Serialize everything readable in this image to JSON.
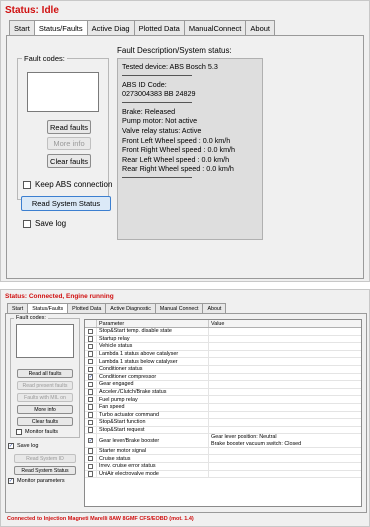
{
  "top": {
    "status": "Status: Idle",
    "tabs": [
      "Start",
      "Status/Faults",
      "Active Diag",
      "Plotted Data",
      "ManualConnect",
      "About"
    ],
    "active_tab": "Status/Faults",
    "fault_codes_label": "Fault codes:",
    "read_faults": "Read faults",
    "more_info": "More info",
    "clear_faults": "Clear faults",
    "keep_abs_connection": "Keep ABS connection",
    "read_system_status": "Read System Status",
    "save_log": "Save log",
    "fault_desc_label": "Fault Description/System status:",
    "fault_desc": {
      "tested_device": "Tested device: ABS Bosch 5.3",
      "abs_id_label": "ABS ID Code:",
      "abs_id_value": "0273004383  BB 24829",
      "brake": "Brake: Released",
      "pump_motor": "Pump motor: Not active",
      "valve_relay": "Valve relay status: Active",
      "fl_speed": "Front Left Wheel speed  : 0.0 km/h",
      "fr_speed": "Front Right Wheel speed : 0.0 km/h",
      "rl_speed": "Rear Left Wheel speed   : 0.0 km/h",
      "rr_speed": "Rear Right Wheel speed  : 0.0 km/h"
    }
  },
  "bottom": {
    "status": "Status: Connected, Engine running",
    "tabs": [
      "Start",
      "Status/Faults",
      "Plotted Data",
      "Active Diagnostic",
      "Manual Connect",
      "About"
    ],
    "active_tab": "Status/Faults",
    "fault_codes_label": "Fault codes:",
    "buttons": {
      "read_all_faults": "Read all faults",
      "read_present_faults": "Read present faults",
      "faults_with_mil": "Faults with MIL on",
      "more_info": "More info",
      "clear_faults": "Clear faults",
      "read_system_id": "Read System ID",
      "read_system_status": "Read System Status"
    },
    "monitor_faults": "Monitor faults",
    "save_log": "Save log",
    "monitor_parameters": "Monitor parameters",
    "table": {
      "col_parameter": "Parameter",
      "col_value": "Value",
      "rows": [
        {
          "name": "Stop&Start temp. disable state",
          "checked": false,
          "value": ""
        },
        {
          "name": "Startup relay",
          "checked": false,
          "value": ""
        },
        {
          "name": "Vehicle status",
          "checked": false,
          "value": ""
        },
        {
          "name": "Lambda 1 status above catalyser",
          "checked": false,
          "value": ""
        },
        {
          "name": "Lambda 1 status below catalyser",
          "checked": false,
          "value": ""
        },
        {
          "name": "Conditioner status",
          "checked": false,
          "value": ""
        },
        {
          "name": "Conditioner compressor",
          "checked": true,
          "value": ""
        },
        {
          "name": "Gear engaged",
          "checked": false,
          "value": ""
        },
        {
          "name": "Acceler./Clutch/Brake status",
          "checked": false,
          "value": ""
        },
        {
          "name": "Fuel pump relay",
          "checked": false,
          "value": ""
        },
        {
          "name": "Fan speed",
          "checked": false,
          "value": ""
        },
        {
          "name": "Turbo actuator command",
          "checked": false,
          "value": ""
        },
        {
          "name": "Stop&Start function",
          "checked": false,
          "value": ""
        },
        {
          "name": "Stop&Start request",
          "checked": false,
          "value": ""
        },
        {
          "name": "Gear lever/Brake booster",
          "checked": true,
          "value": "Gear lever position: Neutral\nBrake booster vacuum switch: Closed"
        },
        {
          "name": "Starter motor signal",
          "checked": false,
          "value": ""
        },
        {
          "name": "Cruise status",
          "checked": false,
          "value": ""
        },
        {
          "name": "Irrev. cruise error status",
          "checked": false,
          "value": ""
        },
        {
          "name": "UniAir electrovalve mode",
          "checked": false,
          "value": ""
        }
      ]
    },
    "footer": "Connected to Injection Magneti Marelli 8AW 8GMF CFS/EOBD (mot. 1.4)"
  }
}
